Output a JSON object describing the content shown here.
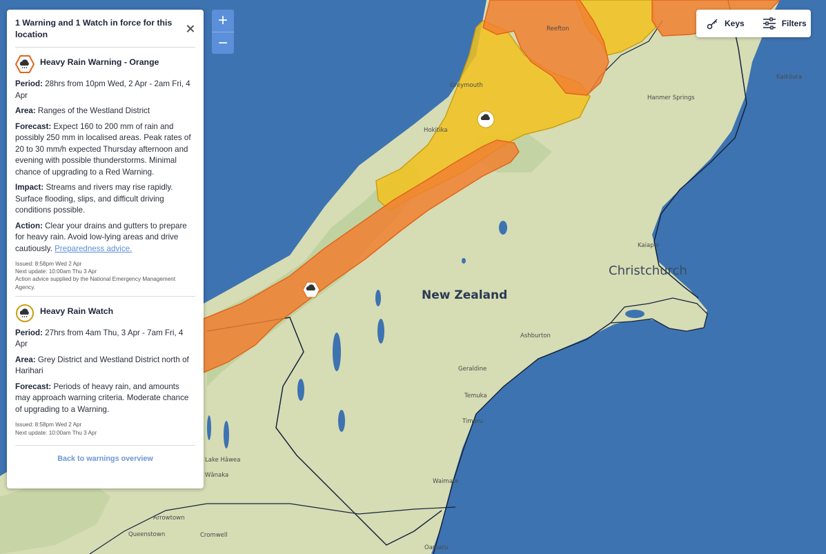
{
  "panel": {
    "header": "1 Warning and 1 Watch in force for this location",
    "warnings": [
      {
        "title": "Heavy Rain Warning - Orange",
        "icon": "rain-cloud-hexagon-orange-icon",
        "period_label": "Period:",
        "period": "28hrs from 10pm Wed, 2 Apr - 2am Fri, 4 Apr",
        "area_label": "Area:",
        "area": "Ranges of the Westland District",
        "forecast_label": "Forecast:",
        "forecast": "Expect 160 to 200 mm of rain and possibly 250 mm in localised areas. Peak rates of 20 to 30 mm/h expected Thursday afternoon and evening with possible thunderstorms. Minimal chance of upgrading to a Red Warning.",
        "impact_label": "Impact:",
        "impact": "Streams and rivers may rise rapidly. Surface flooding, slips, and difficult driving conditions possible.",
        "action_label": "Action:",
        "action": "Clear your drains and gutters to prepare for heavy rain. Avoid low-lying areas and drive cautiously.",
        "action_link": "Preparedness advice.",
        "issued": "Issued: 8:58pm Wed 2 Apr",
        "next_update": "Next update: 10:00am Thu 3 Apr",
        "supplied": "Action advice supplied by the National Emergency Management Agency."
      },
      {
        "title": "Heavy Rain Watch",
        "icon": "rain-cloud-circle-yellow-icon",
        "period_label": "Period:",
        "period": "27hrs from 4am Thu, 3 Apr - 7am Fri, 4 Apr",
        "area_label": "Area:",
        "area": "Grey District and Westland District north of Harihari",
        "forecast_label": "Forecast:",
        "forecast": "Periods of heavy rain, and amounts may approach warning criteria. Moderate chance of upgrading to a Warning.",
        "issued": "Issued: 8:58pm Wed 2 Apr",
        "next_update": "Next update: 10:00am Thu 3 Apr"
      }
    ],
    "back_link": "Back to warnings overview"
  },
  "zoom": {
    "in": "+",
    "out": "−"
  },
  "toolbar": {
    "keys": "Keys",
    "filters": "Filters"
  },
  "map": {
    "country": "New Zealand",
    "city": "Christchurch",
    "places": {
      "reefton": "Reefton",
      "greymouth": "Greymouth",
      "hokitika": "Hokitika",
      "hanmer": "Hanmer Springs",
      "kaikoura": "Kaikōura",
      "kaiapoi": "Kaiapoi",
      "ashburton": "Ashburton",
      "geraldine": "Geraldine",
      "temuka": "Temuka",
      "timaru": "Timaru",
      "waimate": "Waimate",
      "lake_hawea": "Lake Hāwea",
      "wanaka": "Wānaka",
      "arrowtown": "Arrowtown",
      "queenstown": "Queenstown",
      "cromwell": "Cromwell",
      "oamaru": "Oamaru"
    },
    "colors": {
      "sea": "#3d73b0",
      "land": "#d6dcb4",
      "warning_orange": "#f08030",
      "watch_yellow": "#f2c21f",
      "border": "#15233d",
      "link": "#5b8fd9"
    }
  }
}
